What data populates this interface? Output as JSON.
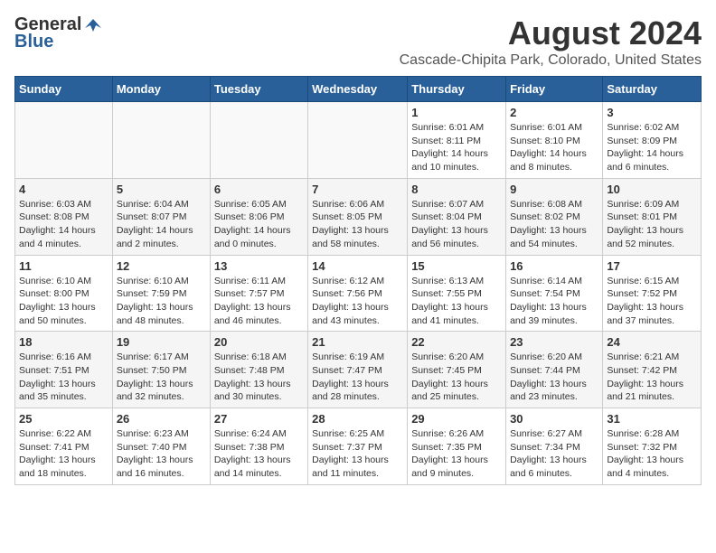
{
  "header": {
    "logo_general": "General",
    "logo_blue": "Blue",
    "month_year": "August 2024",
    "location": "Cascade-Chipita Park, Colorado, United States"
  },
  "weekdays": [
    "Sunday",
    "Monday",
    "Tuesday",
    "Wednesday",
    "Thursday",
    "Friday",
    "Saturday"
  ],
  "weeks": [
    [
      {
        "day": "",
        "info": ""
      },
      {
        "day": "",
        "info": ""
      },
      {
        "day": "",
        "info": ""
      },
      {
        "day": "",
        "info": ""
      },
      {
        "day": "1",
        "info": "Sunrise: 6:01 AM\nSunset: 8:11 PM\nDaylight: 14 hours\nand 10 minutes."
      },
      {
        "day": "2",
        "info": "Sunrise: 6:01 AM\nSunset: 8:10 PM\nDaylight: 14 hours\nand 8 minutes."
      },
      {
        "day": "3",
        "info": "Sunrise: 6:02 AM\nSunset: 8:09 PM\nDaylight: 14 hours\nand 6 minutes."
      }
    ],
    [
      {
        "day": "4",
        "info": "Sunrise: 6:03 AM\nSunset: 8:08 PM\nDaylight: 14 hours\nand 4 minutes."
      },
      {
        "day": "5",
        "info": "Sunrise: 6:04 AM\nSunset: 8:07 PM\nDaylight: 14 hours\nand 2 minutes."
      },
      {
        "day": "6",
        "info": "Sunrise: 6:05 AM\nSunset: 8:06 PM\nDaylight: 14 hours\nand 0 minutes."
      },
      {
        "day": "7",
        "info": "Sunrise: 6:06 AM\nSunset: 8:05 PM\nDaylight: 13 hours\nand 58 minutes."
      },
      {
        "day": "8",
        "info": "Sunrise: 6:07 AM\nSunset: 8:04 PM\nDaylight: 13 hours\nand 56 minutes."
      },
      {
        "day": "9",
        "info": "Sunrise: 6:08 AM\nSunset: 8:02 PM\nDaylight: 13 hours\nand 54 minutes."
      },
      {
        "day": "10",
        "info": "Sunrise: 6:09 AM\nSunset: 8:01 PM\nDaylight: 13 hours\nand 52 minutes."
      }
    ],
    [
      {
        "day": "11",
        "info": "Sunrise: 6:10 AM\nSunset: 8:00 PM\nDaylight: 13 hours\nand 50 minutes."
      },
      {
        "day": "12",
        "info": "Sunrise: 6:10 AM\nSunset: 7:59 PM\nDaylight: 13 hours\nand 48 minutes."
      },
      {
        "day": "13",
        "info": "Sunrise: 6:11 AM\nSunset: 7:57 PM\nDaylight: 13 hours\nand 46 minutes."
      },
      {
        "day": "14",
        "info": "Sunrise: 6:12 AM\nSunset: 7:56 PM\nDaylight: 13 hours\nand 43 minutes."
      },
      {
        "day": "15",
        "info": "Sunrise: 6:13 AM\nSunset: 7:55 PM\nDaylight: 13 hours\nand 41 minutes."
      },
      {
        "day": "16",
        "info": "Sunrise: 6:14 AM\nSunset: 7:54 PM\nDaylight: 13 hours\nand 39 minutes."
      },
      {
        "day": "17",
        "info": "Sunrise: 6:15 AM\nSunset: 7:52 PM\nDaylight: 13 hours\nand 37 minutes."
      }
    ],
    [
      {
        "day": "18",
        "info": "Sunrise: 6:16 AM\nSunset: 7:51 PM\nDaylight: 13 hours\nand 35 minutes."
      },
      {
        "day": "19",
        "info": "Sunrise: 6:17 AM\nSunset: 7:50 PM\nDaylight: 13 hours\nand 32 minutes."
      },
      {
        "day": "20",
        "info": "Sunrise: 6:18 AM\nSunset: 7:48 PM\nDaylight: 13 hours\nand 30 minutes."
      },
      {
        "day": "21",
        "info": "Sunrise: 6:19 AM\nSunset: 7:47 PM\nDaylight: 13 hours\nand 28 minutes."
      },
      {
        "day": "22",
        "info": "Sunrise: 6:20 AM\nSunset: 7:45 PM\nDaylight: 13 hours\nand 25 minutes."
      },
      {
        "day": "23",
        "info": "Sunrise: 6:20 AM\nSunset: 7:44 PM\nDaylight: 13 hours\nand 23 minutes."
      },
      {
        "day": "24",
        "info": "Sunrise: 6:21 AM\nSunset: 7:42 PM\nDaylight: 13 hours\nand 21 minutes."
      }
    ],
    [
      {
        "day": "25",
        "info": "Sunrise: 6:22 AM\nSunset: 7:41 PM\nDaylight: 13 hours\nand 18 minutes."
      },
      {
        "day": "26",
        "info": "Sunrise: 6:23 AM\nSunset: 7:40 PM\nDaylight: 13 hours\nand 16 minutes."
      },
      {
        "day": "27",
        "info": "Sunrise: 6:24 AM\nSunset: 7:38 PM\nDaylight: 13 hours\nand 14 minutes."
      },
      {
        "day": "28",
        "info": "Sunrise: 6:25 AM\nSunset: 7:37 PM\nDaylight: 13 hours\nand 11 minutes."
      },
      {
        "day": "29",
        "info": "Sunrise: 6:26 AM\nSunset: 7:35 PM\nDaylight: 13 hours\nand 9 minutes."
      },
      {
        "day": "30",
        "info": "Sunrise: 6:27 AM\nSunset: 7:34 PM\nDaylight: 13 hours\nand 6 minutes."
      },
      {
        "day": "31",
        "info": "Sunrise: 6:28 AM\nSunset: 7:32 PM\nDaylight: 13 hours\nand 4 minutes."
      }
    ]
  ]
}
